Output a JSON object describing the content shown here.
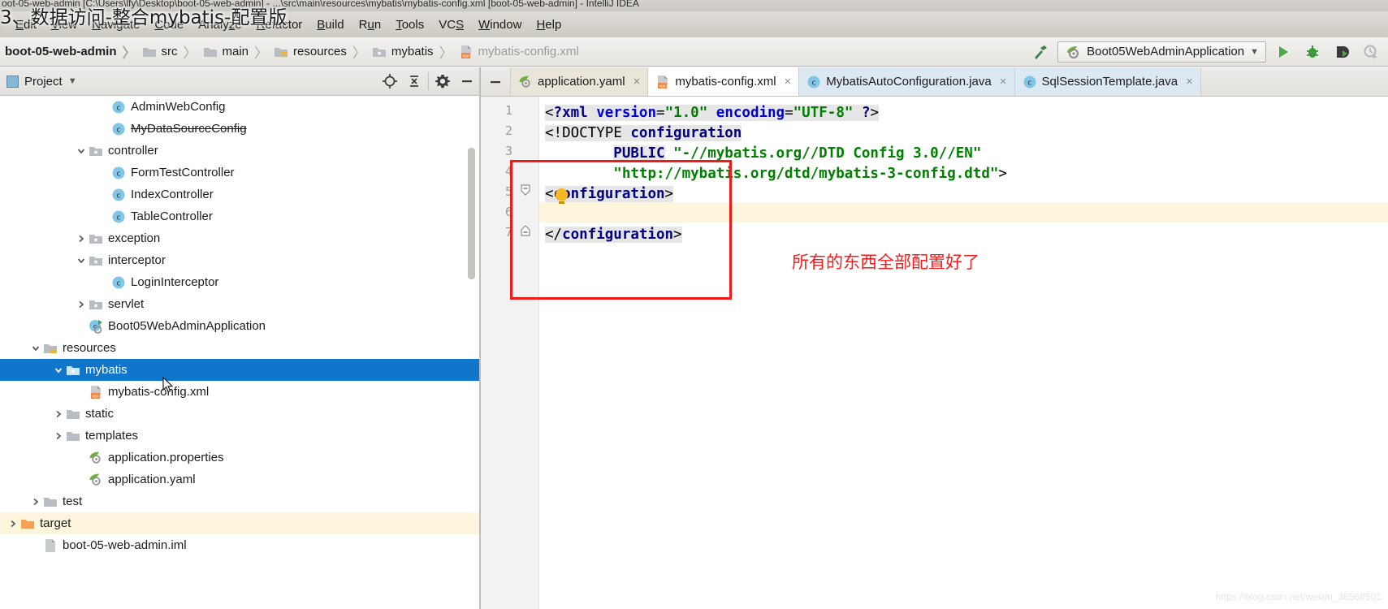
{
  "window": {
    "title": "oot-05-web-admin [C:\\Users\\lfy\\Desktop\\boot-05-web-admin] - ...\\src\\main\\resources\\mybatis\\mybatis-config.xml [boot-05-web-admin] - IntelliJ IDEA",
    "overlay_title": "3、数据访问-整合mybatis-配置版"
  },
  "menubar": {
    "items": [
      {
        "label": "Edit",
        "mnemonic": "E"
      },
      {
        "label": "View",
        "mnemonic": "V"
      },
      {
        "label": "Navigate",
        "mnemonic": "N"
      },
      {
        "label": "Code",
        "mnemonic": "C"
      },
      {
        "label": "Analyze",
        "mnemonic": "z"
      },
      {
        "label": "Refactor",
        "mnemonic": "R"
      },
      {
        "label": "Build",
        "mnemonic": "B"
      },
      {
        "label": "Run",
        "mnemonic": "u"
      },
      {
        "label": "Tools",
        "mnemonic": "T"
      },
      {
        "label": "VCS",
        "mnemonic": "S"
      },
      {
        "label": "Window",
        "mnemonic": "W"
      },
      {
        "label": "Help",
        "mnemonic": "H"
      }
    ]
  },
  "breadcrumb": {
    "items": [
      {
        "label": "boot-05-web-admin",
        "icon": "module-icon",
        "style": "bold"
      },
      {
        "label": "src",
        "icon": "folder-icon",
        "style": "normal"
      },
      {
        "label": "main",
        "icon": "folder-icon",
        "style": "normal"
      },
      {
        "label": "resources",
        "icon": "resources-folder-icon",
        "style": "normal"
      },
      {
        "label": "mybatis",
        "icon": "package-folder-icon",
        "style": "normal"
      },
      {
        "label": "mybatis-config.xml",
        "icon": "xml-file-icon",
        "style": "dim"
      }
    ]
  },
  "toolbar": {
    "build_icon": "hammer-icon",
    "run_config": "Boot05WebAdminApplication",
    "run_config_icon": "spring-boot-icon",
    "dropdown_icon": "chevron-down-icon",
    "buttons": [
      {
        "name": "run-button",
        "icon": "play-icon",
        "enabled": true
      },
      {
        "name": "debug-button",
        "icon": "bug-icon",
        "enabled": true
      },
      {
        "name": "run-with-coverage-button",
        "icon": "coverage-icon",
        "enabled": true
      },
      {
        "name": "profile-button",
        "icon": "profiler-icon",
        "enabled": false
      }
    ]
  },
  "project_panel": {
    "title": "Project",
    "title_icon": "project-window-icon",
    "dropdown_icon": "chevron-down-icon",
    "actions": [
      {
        "name": "locate-file-button",
        "icon": "target-icon"
      },
      {
        "name": "collapse-all-button",
        "icon": "collapse-all-icon"
      },
      {
        "name": "settings-button",
        "icon": "gear-icon"
      },
      {
        "name": "hide-button",
        "icon": "minimize-icon"
      }
    ],
    "tree": [
      {
        "label": "AdminWebConfig",
        "icon": "class-icon",
        "indent": 5,
        "arrow": "none",
        "state": "normal"
      },
      {
        "label": "MyDataSourceConfig",
        "icon": "class-icon",
        "indent": 5,
        "arrow": "none",
        "state": "strike"
      },
      {
        "label": "controller",
        "icon": "package-icon",
        "indent": 4,
        "arrow": "expanded",
        "state": "normal"
      },
      {
        "label": "FormTestController",
        "icon": "class-icon",
        "indent": 5,
        "arrow": "none",
        "state": "normal"
      },
      {
        "label": "IndexController",
        "icon": "class-icon",
        "indent": 5,
        "arrow": "none",
        "state": "normal"
      },
      {
        "label": "TableController",
        "icon": "class-icon",
        "indent": 5,
        "arrow": "none",
        "state": "normal"
      },
      {
        "label": "exception",
        "icon": "package-icon",
        "indent": 4,
        "arrow": "collapsed",
        "state": "normal"
      },
      {
        "label": "interceptor",
        "icon": "package-icon",
        "indent": 4,
        "arrow": "expanded",
        "state": "normal"
      },
      {
        "label": "LoginInterceptor",
        "icon": "class-icon",
        "indent": 5,
        "arrow": "none",
        "state": "normal"
      },
      {
        "label": "servlet",
        "icon": "package-icon",
        "indent": 4,
        "arrow": "collapsed",
        "state": "normal"
      },
      {
        "label": "Boot05WebAdminApplication",
        "icon": "spring-class-icon",
        "indent": 4,
        "arrow": "none",
        "state": "normal"
      },
      {
        "label": "resources",
        "icon": "resources-folder-icon",
        "indent": 2,
        "arrow": "expanded",
        "state": "normal"
      },
      {
        "label": "mybatis",
        "icon": "package-folder-icon",
        "indent": 3,
        "arrow": "expanded",
        "state": "selected"
      },
      {
        "label": "mybatis-config.xml",
        "icon": "xml-file-icon",
        "indent": 4,
        "arrow": "none",
        "state": "normal"
      },
      {
        "label": "static",
        "icon": "folder-icon",
        "indent": 3,
        "arrow": "collapsed",
        "state": "normal"
      },
      {
        "label": "templates",
        "icon": "folder-icon",
        "indent": 3,
        "arrow": "collapsed",
        "state": "normal"
      },
      {
        "label": "application.properties",
        "icon": "spring-file-icon",
        "indent": 4,
        "arrow": "none",
        "state": "normal"
      },
      {
        "label": "application.yaml",
        "icon": "spring-file-icon",
        "indent": 4,
        "arrow": "none",
        "state": "normal"
      },
      {
        "label": "test",
        "icon": "folder-icon",
        "indent": 2,
        "arrow": "collapsed",
        "state": "normal"
      },
      {
        "label": "target",
        "icon": "target-folder-icon",
        "indent": 1,
        "arrow": "collapsed",
        "state": "highlight"
      },
      {
        "label": "boot-05-web-admin.iml",
        "icon": "iml-file-icon",
        "indent": 2,
        "arrow": "none",
        "state": "normal"
      }
    ]
  },
  "editor_tabs": [
    {
      "label": "application.yaml",
      "icon": "spring-file-icon",
      "active": false,
      "close_icon": "close-icon",
      "kind": "yaml"
    },
    {
      "label": "mybatis-config.xml",
      "icon": "xml-file-icon",
      "active": true,
      "close_icon": "close-icon",
      "kind": "active"
    },
    {
      "label": "MybatisAutoConfiguration.java",
      "icon": "class-icon",
      "active": false,
      "close_icon": "close-icon",
      "kind": "java"
    },
    {
      "label": "SqlSessionTemplate.java",
      "icon": "class-icon",
      "active": false,
      "close_icon": "close-icon",
      "kind": "java"
    }
  ],
  "editor": {
    "line_numbers": [
      "1",
      "2",
      "3",
      "4",
      "5",
      "6",
      "7"
    ],
    "caret_line": 6,
    "lines": [
      {
        "n": 1,
        "text": "<?xml version=\"1.0\" encoding=\"UTF-8\" ?>"
      },
      {
        "n": 2,
        "text": "<!DOCTYPE configuration"
      },
      {
        "n": 3,
        "text": "        PUBLIC \"-//mybatis.org//DTD Config 3.0//EN\""
      },
      {
        "n": 4,
        "text": "        \"http://mybatis.org/dtd/mybatis-3-config.dtd\">"
      },
      {
        "n": 5,
        "text": "<configuration>"
      },
      {
        "n": 6,
        "text": ""
      },
      {
        "n": 7,
        "text": "</configuration>"
      }
    ],
    "intention_bulb": "lightbulb-icon",
    "fold_markers": [
      {
        "line": 5,
        "icon": "fold-open-icon"
      },
      {
        "line": 7,
        "icon": "fold-end-icon"
      }
    ]
  },
  "annotation": {
    "text": "所有的东西全部配置好了",
    "color": "#f41c1c",
    "box_color": "#ef1b1b"
  },
  "watermark": "https://blog.csdn.net/weixin_38568501",
  "colors": {
    "selection_blue": "#1076cc",
    "caret_line_yellow": "#fdf6dd",
    "xml_tag": "#000080",
    "xml_string": "#008000",
    "xml_attr": "#0000cc",
    "accent_red": "#ef1b1b"
  }
}
